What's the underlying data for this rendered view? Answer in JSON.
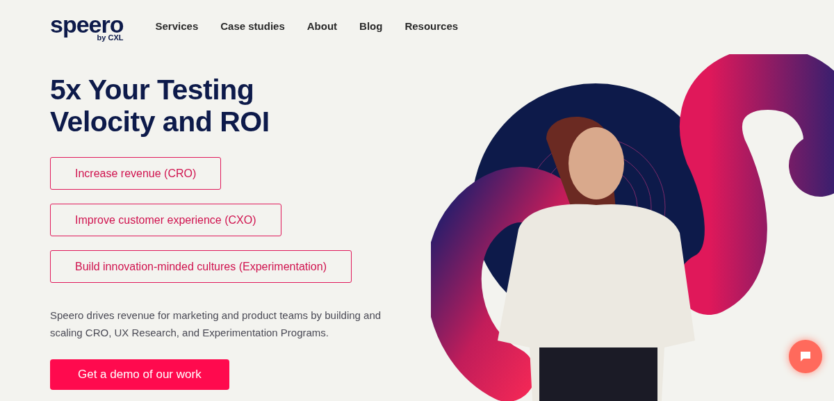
{
  "logo": {
    "wordmark": "speero",
    "byline": "by CXL"
  },
  "nav": [
    "Services",
    "Case studies",
    "About",
    "Blog",
    "Resources"
  ],
  "hero": {
    "title_lines": [
      "5x Your Testing",
      "Velocity and ROI"
    ],
    "options": [
      "Increase revenue (CRO)",
      "Improve customer experience (CXO)",
      "Build innovation-minded cultures (Experimentation)"
    ],
    "description": "Speero drives revenue for marketing and product teams by building and scaling CRO, UX Research, and Experimentation Programs.",
    "cta": "Get a demo of our work"
  }
}
